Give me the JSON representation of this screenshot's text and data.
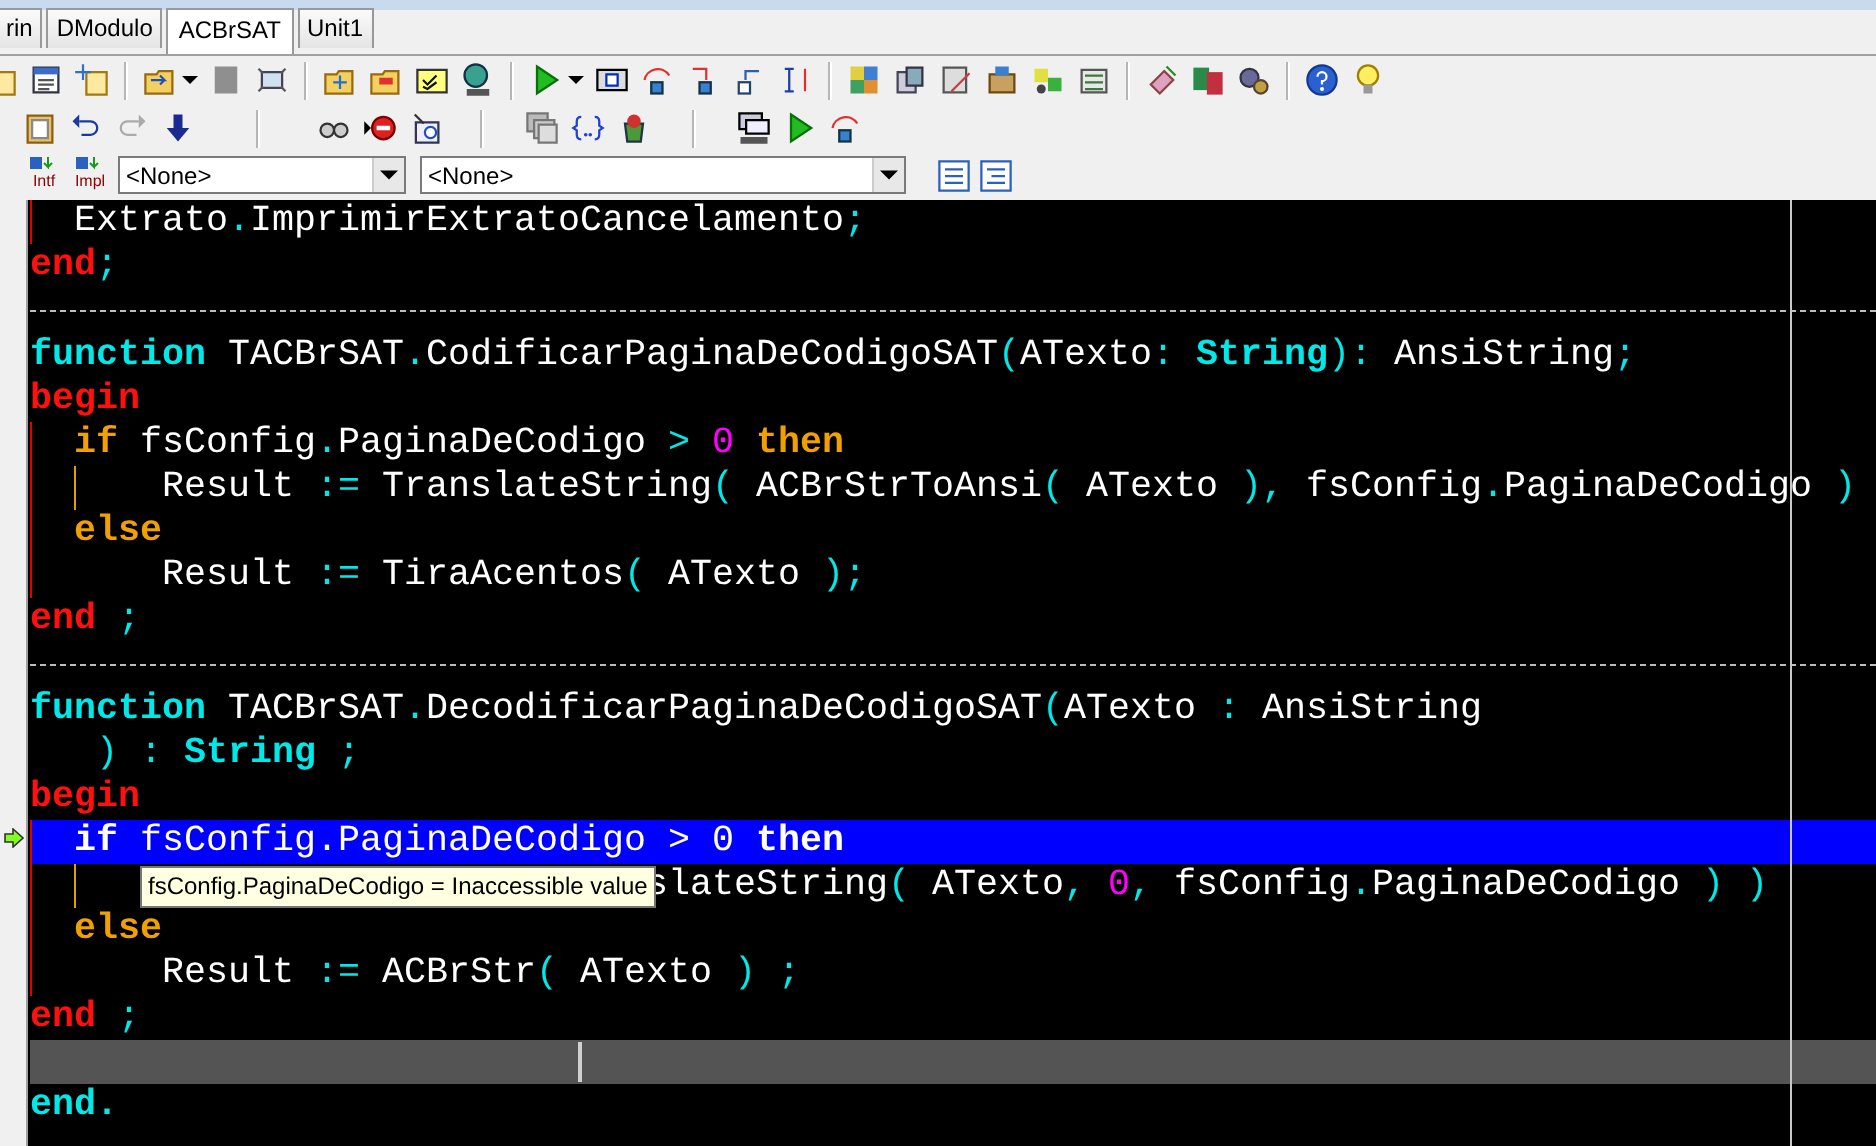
{
  "tabs": [
    {
      "label": "rin",
      "selected": false
    },
    {
      "label": "DModulo",
      "selected": false
    },
    {
      "label": "ACBrSAT",
      "selected": true
    },
    {
      "label": "Unit1",
      "selected": false
    }
  ],
  "nav_toolbar": {
    "buttons": [
      {
        "label": "Intf"
      },
      {
        "label": "Impl"
      }
    ],
    "combos": [
      {
        "value": "<None>"
      },
      {
        "value": "<None>"
      }
    ]
  },
  "editor": {
    "lines": [
      {
        "kind": "code",
        "block_guide": true,
        "tokens": [
          {
            "kind": "text",
            "text": "  Extrato"
          },
          {
            "kind": "sym",
            "text": "."
          },
          {
            "kind": "text",
            "text": "ImprimirExtratoCancelamento"
          },
          {
            "kind": "sym",
            "text": ";"
          }
        ]
      },
      {
        "kind": "code",
        "tokens": [
          {
            "kind": "block",
            "text": "end"
          },
          {
            "kind": "sym",
            "text": ";"
          }
        ]
      },
      {
        "kind": "separator"
      },
      {
        "kind": "code",
        "tokens": [
          {
            "kind": "reserved",
            "text": "function"
          },
          {
            "kind": "text",
            "text": " TACBrSAT"
          },
          {
            "kind": "sym",
            "text": "."
          },
          {
            "kind": "text",
            "text": "CodificarPaginaDeCodigoSAT"
          },
          {
            "kind": "sym",
            "text": "("
          },
          {
            "kind": "text",
            "text": "ATexto"
          },
          {
            "kind": "sym",
            "text": ": "
          },
          {
            "kind": "reserved",
            "text": "String"
          },
          {
            "kind": "sym",
            "text": "): "
          },
          {
            "kind": "text",
            "text": "AnsiString"
          },
          {
            "kind": "sym",
            "text": ";"
          }
        ]
      },
      {
        "kind": "code",
        "tokens": [
          {
            "kind": "block",
            "text": "begin"
          }
        ]
      },
      {
        "kind": "code",
        "block_guide": true,
        "tokens": [
          {
            "kind": "cond",
            "text": "  if"
          },
          {
            "kind": "text",
            "text": " fsConfig"
          },
          {
            "kind": "sym",
            "text": "."
          },
          {
            "kind": "text",
            "text": "PaginaDeCodigo "
          },
          {
            "kind": "sym",
            "text": ">"
          },
          {
            "kind": "num",
            "text": " 0"
          },
          {
            "kind": "cond",
            "text": " then"
          }
        ]
      },
      {
        "kind": "code",
        "block_guide": true,
        "branch_guide": true,
        "tokens": [
          {
            "kind": "text",
            "text": "      Result "
          },
          {
            "kind": "sym",
            "text": ":="
          },
          {
            "kind": "text",
            "text": " TranslateString"
          },
          {
            "kind": "sym",
            "text": "("
          },
          {
            "kind": "text",
            "text": " ACBrStrToAnsi"
          },
          {
            "kind": "sym",
            "text": "("
          },
          {
            "kind": "text",
            "text": " ATexto "
          },
          {
            "kind": "sym",
            "text": "),"
          },
          {
            "kind": "text",
            "text": " fsConfig"
          },
          {
            "kind": "sym",
            "text": "."
          },
          {
            "kind": "text",
            "text": "PaginaDeCodigo "
          },
          {
            "kind": "sym",
            "text": ")"
          }
        ]
      },
      {
        "kind": "code",
        "block_guide": true,
        "tokens": [
          {
            "kind": "cond",
            "text": "  else"
          }
        ]
      },
      {
        "kind": "code",
        "block_guide": true,
        "tokens": [
          {
            "kind": "text",
            "text": "      Result "
          },
          {
            "kind": "sym",
            "text": ":="
          },
          {
            "kind": "text",
            "text": " TiraAcentos"
          },
          {
            "kind": "sym",
            "text": "("
          },
          {
            "kind": "text",
            "text": " ATexto "
          },
          {
            "kind": "sym",
            "text": ");"
          }
        ]
      },
      {
        "kind": "code",
        "tokens": [
          {
            "kind": "block",
            "text": "end"
          },
          {
            "kind": "sym",
            "text": " ;"
          }
        ]
      },
      {
        "kind": "separator"
      },
      {
        "kind": "code",
        "tokens": [
          {
            "kind": "reserved",
            "text": "function"
          },
          {
            "kind": "text",
            "text": " TACBrSAT"
          },
          {
            "kind": "sym",
            "text": "."
          },
          {
            "kind": "text",
            "text": "DecodificarPaginaDeCodigoSAT"
          },
          {
            "kind": "sym",
            "text": "("
          },
          {
            "kind": "text",
            "text": "ATexto "
          },
          {
            "kind": "sym",
            "text": ":"
          },
          {
            "kind": "text",
            "text": " AnsiString"
          }
        ]
      },
      {
        "kind": "code",
        "tokens": [
          {
            "kind": "sym",
            "text": "   ) :"
          },
          {
            "kind": "reserved",
            "text": " String"
          },
          {
            "kind": "sym",
            "text": " ;"
          }
        ]
      },
      {
        "kind": "code",
        "tokens": [
          {
            "kind": "block",
            "text": "begin"
          }
        ]
      },
      {
        "kind": "execution",
        "block_guide": true,
        "tokens": [
          {
            "kind": "cond",
            "text": "  if"
          },
          {
            "kind": "text",
            "text": " fsConfig"
          },
          {
            "kind": "sym",
            "text": "."
          },
          {
            "kind": "text",
            "text": "PaginaDeCodigo "
          },
          {
            "kind": "sym",
            "text": ">"
          },
          {
            "kind": "num",
            "text": " 0"
          },
          {
            "kind": "cond",
            "text": " then"
          }
        ]
      },
      {
        "kind": "covered",
        "block_guide": true,
        "branch_guide": true,
        "tooltip": "fsConfig.PaginaDeCodigo = Inaccessible value",
        "tokens": [
          {
            "kind": "text",
            "text": "slateString"
          },
          {
            "kind": "sym",
            "text": "("
          },
          {
            "kind": "text",
            "text": " ATexto"
          },
          {
            "kind": "sym",
            "text": ","
          },
          {
            "kind": "num",
            "text": " 0"
          },
          {
            "kind": "sym",
            "text": ","
          },
          {
            "kind": "text",
            "text": " fsConfig"
          },
          {
            "kind": "sym",
            "text": "."
          },
          {
            "kind": "text",
            "text": "PaginaDeCodigo "
          },
          {
            "kind": "sym",
            "text": ") )"
          }
        ]
      },
      {
        "kind": "code",
        "block_guide": true,
        "tokens": [
          {
            "kind": "cond",
            "text": "  else"
          }
        ]
      },
      {
        "kind": "code",
        "block_guide": true,
        "tokens": [
          {
            "kind": "text",
            "text": "      Result "
          },
          {
            "kind": "sym",
            "text": ":="
          },
          {
            "kind": "text",
            "text": " ACBrStr"
          },
          {
            "kind": "sym",
            "text": "("
          },
          {
            "kind": "text",
            "text": " ATexto "
          },
          {
            "kind": "sym",
            "text": ") ;"
          }
        ]
      },
      {
        "kind": "code",
        "tokens": [
          {
            "kind": "block",
            "text": "end"
          },
          {
            "kind": "sym",
            "text": " ;"
          }
        ]
      },
      {
        "kind": "current"
      },
      {
        "kind": "code",
        "tokens": [
          {
            "kind": "reserved",
            "text": "end."
          }
        ]
      }
    ]
  }
}
